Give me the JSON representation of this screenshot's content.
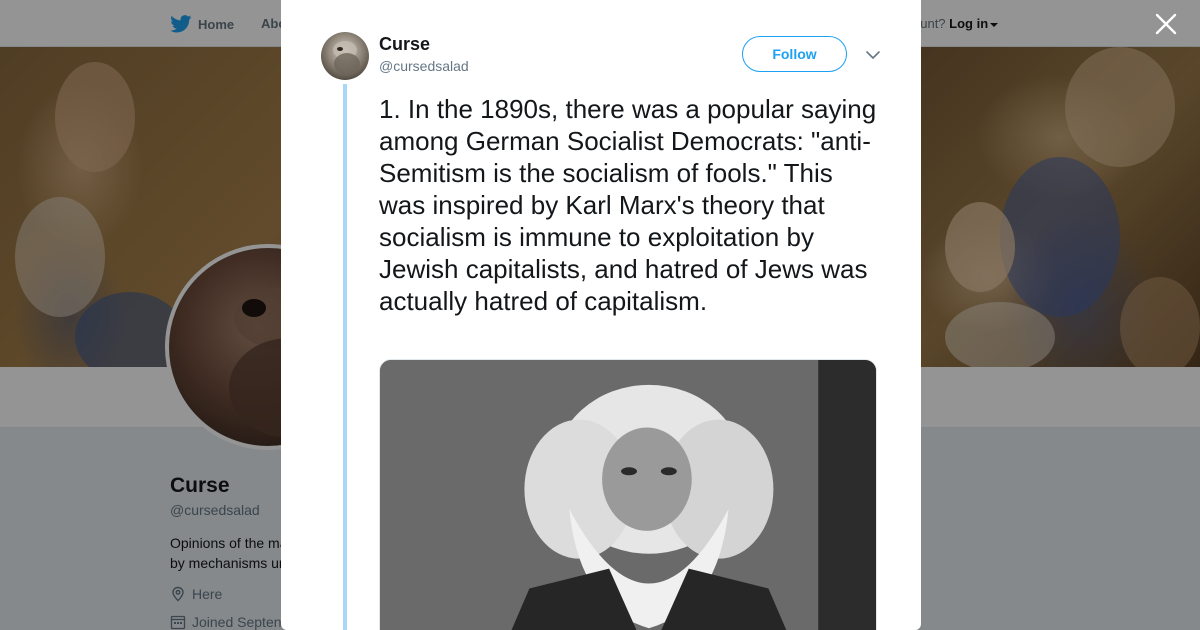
{
  "topbar": {
    "home_label": "Home",
    "about_label": "Abo",
    "account_prompt": "ccount?",
    "login_label": "Log in"
  },
  "profile": {
    "name": "Curse",
    "handle": "@cursedsalad",
    "bio_line1": "Opinions of the ma",
    "bio_line2": "by mechanisms ur",
    "location": "Here",
    "joined": "Joined Septen"
  },
  "tweet": {
    "author_name": "Curse",
    "author_handle": "@cursedsalad",
    "follow_label": "Follow",
    "text": "1. In the 1890s, there was a popular saying among German Socialist Democrats: \"anti-Semitism is the socialism of fools.\" This was inspired by Karl Marx's theory that socialism is immune to exploitation by Jewish capitalists, and hatred of Jews was actually hatred of capitalism."
  },
  "colors": {
    "accent": "#1da1f2",
    "thread_line": "#a8d8f5",
    "text_primary": "#14171a",
    "text_secondary": "#657786"
  },
  "icons": {
    "brand": "twitter-bird-icon",
    "close": "close-icon",
    "more": "chevron-down-icon",
    "location": "location-pin-icon",
    "calendar": "calendar-icon"
  }
}
